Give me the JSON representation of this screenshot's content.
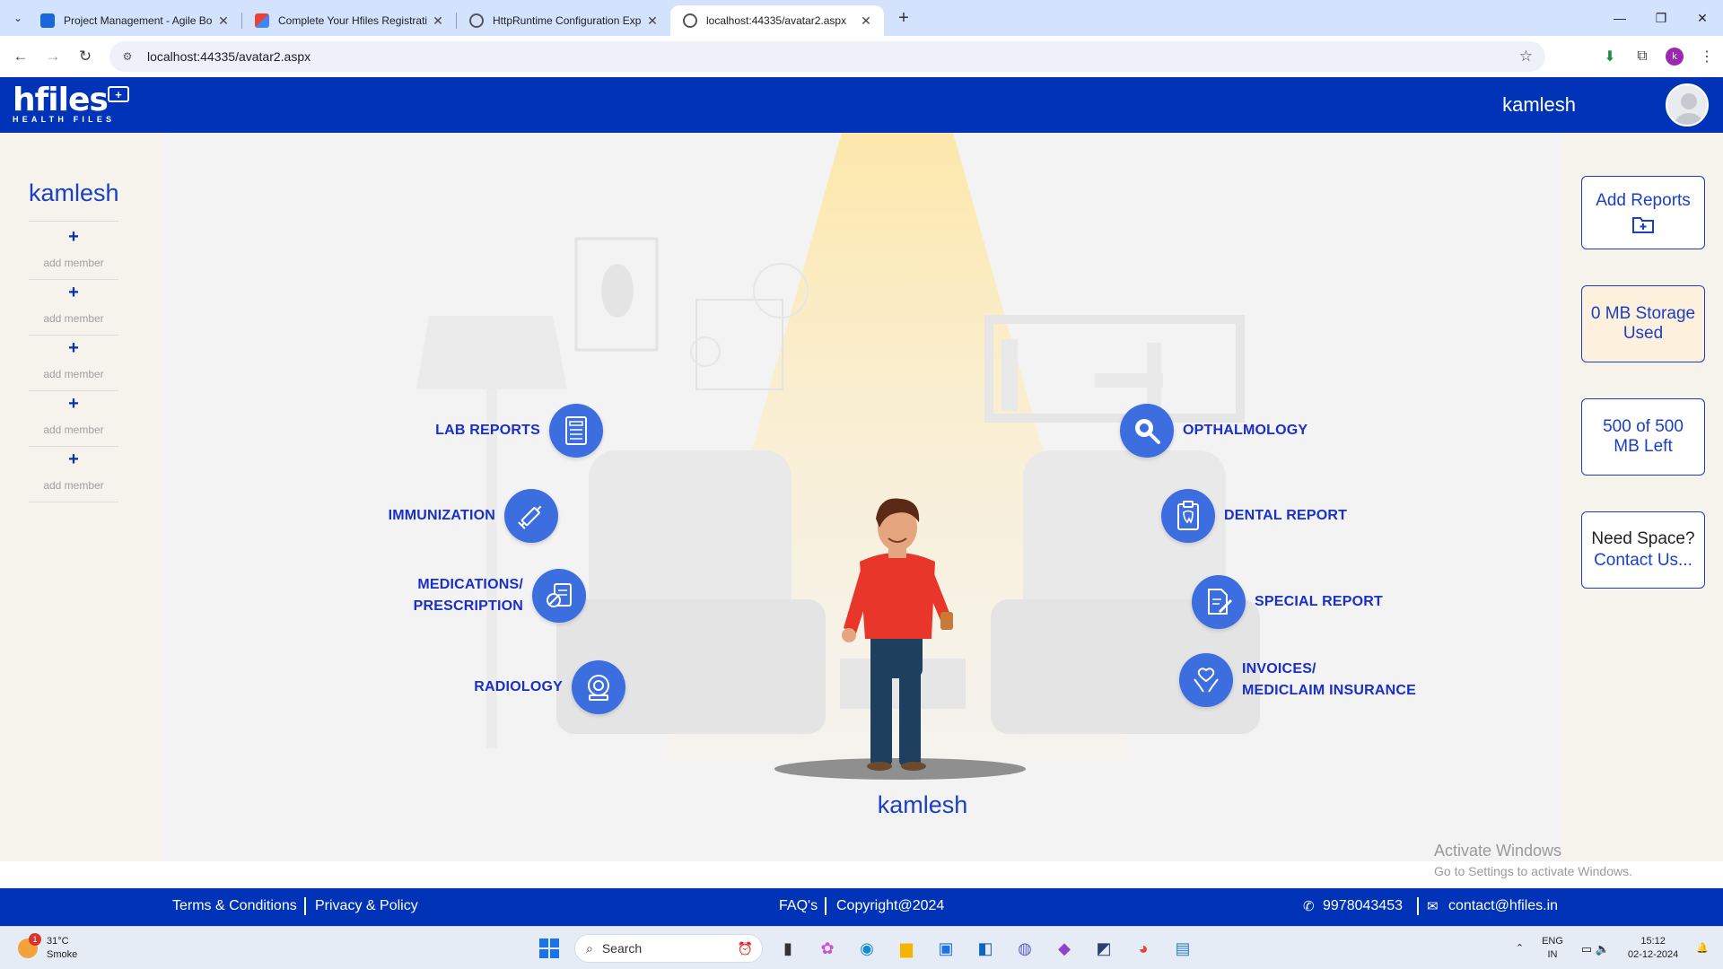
{
  "browser": {
    "tabs": [
      {
        "title": "Project Management - Agile Bo",
        "favicon_color": "#1868db"
      },
      {
        "title": "Complete Your Hfiles Registrati",
        "favicon_color": "#ea4335"
      },
      {
        "title": "HttpRuntime Configuration Exp",
        "favicon_color": "#555555"
      },
      {
        "title": "localhost:44335/avatar2.aspx",
        "favicon_color": "#555555"
      }
    ],
    "url": "localhost:44335/avatar2.aspx",
    "profile_initial": "k"
  },
  "header": {
    "logo_main": "hfiles",
    "logo_sub": "HEALTH FILES",
    "user_name": "kamlesh"
  },
  "left_panel": {
    "user_name": "kamlesh",
    "members": [
      {
        "icon": "+",
        "label": "add member"
      },
      {
        "icon": "+",
        "label": "add member"
      },
      {
        "icon": "+",
        "label": "add member"
      },
      {
        "icon": "+",
        "label": "add member"
      },
      {
        "icon": "+",
        "label": "add member"
      }
    ]
  },
  "categories_left": [
    {
      "label": "LAB REPORTS",
      "icon": "bill-icon"
    },
    {
      "label": "IMMUNIZATION",
      "icon": "syringe-icon"
    },
    {
      "label": "MEDICATIONS/ PRESCRIPTION",
      "line1": "MEDICATIONS/",
      "line2": "PRESCRIPTION",
      "icon": "prescription-icon"
    },
    {
      "label": "RADIOLOGY",
      "icon": "radiology-icon"
    }
  ],
  "categories_right": [
    {
      "label": "OPTHALMOLOGY",
      "icon": "eye-search-icon"
    },
    {
      "label": "DENTAL REPORT",
      "icon": "tooth-report-icon"
    },
    {
      "label": "SPECIAL REPORT",
      "icon": "document-pen-icon"
    },
    {
      "label": "INVOICES/ MEDICLAIM INSURANCE",
      "line1": "INVOICES/",
      "line2": "MEDICLAIM INSURANCE",
      "icon": "insurance-hands-icon"
    }
  ],
  "stage": {
    "avatar_name": "kamlesh"
  },
  "right_panel": {
    "add_reports": "Add Reports",
    "storage_used": "0 MB Storage Used",
    "storage_left": "500 of 500 MB Left",
    "need_space": "Need Space?",
    "contact_us": "Contact Us..."
  },
  "watermark": {
    "line1": "Activate Windows",
    "line2": "Go to Settings to activate Windows."
  },
  "footer": {
    "terms": "Terms & Conditions",
    "privacy": "Privacy & Policy",
    "faqs": "FAQ's",
    "copyright": "Copyright@2024",
    "phone": "9978043453",
    "email": "contact@hfiles.in"
  },
  "taskbar": {
    "weather_temp": "31°C",
    "weather_desc": "Smoke",
    "weather_badge": "1",
    "search_placeholder": "Search",
    "lang_line1": "ENG",
    "lang_line2": "IN",
    "time": "15:12",
    "date": "02-12-2024"
  },
  "colors": {
    "brand_blue": "#0033b8",
    "accent_blue": "#1a3fc4",
    "icon_blue": "#3c6ee0",
    "storage_card_bg": "#fdf1de"
  }
}
